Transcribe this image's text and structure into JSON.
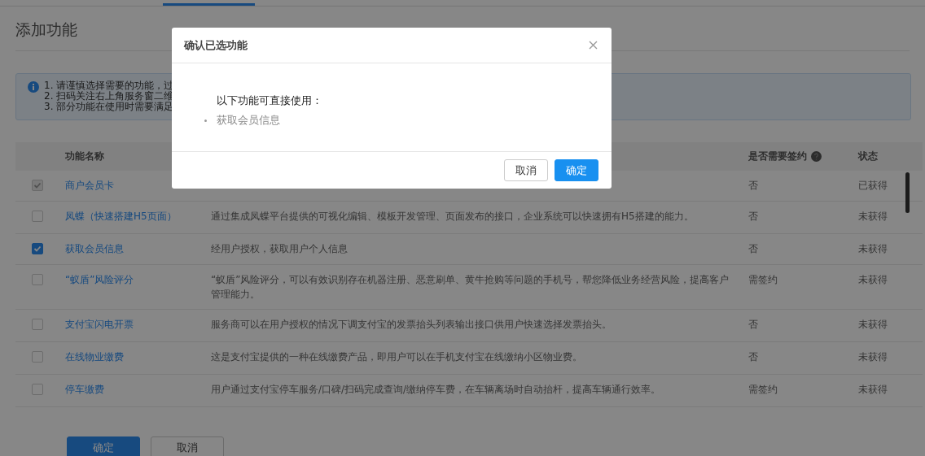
{
  "page": {
    "title": "添加功能"
  },
  "notice": [
    "1. 请谨慎选择需要的功能，过",
    "2. 扫码关注右上角服务窗二维",
    "3. 部分功能在使用时需要满足"
  ],
  "table": {
    "columns": [
      "功能名称",
      "是否需要签约",
      "状态"
    ],
    "rows": [
      {
        "name": "商户会员卡",
        "checked": true,
        "disabled": true,
        "sign": "否",
        "status": "已获得"
      },
      {
        "name": "凤蝶（快速搭建H5页面）",
        "checked": false,
        "disabled": false,
        "description": "通过集成凤蝶平台提供的可视化编辑、模板开发管理、页面发布的接口，企业系统可以快速拥有H5搭建的能力。",
        "sign": "否",
        "status": "未获得"
      },
      {
        "name": "获取会员信息",
        "checked": true,
        "disabled": false,
        "description": "经用户授权，获取用户个人信息",
        "sign": "否",
        "status": "未获得"
      },
      {
        "name": "“蚁盾”风险评分",
        "checked": false,
        "disabled": false,
        "description": "“蚁盾”风险评分，可以有效识别存在机器注册、恶意刷单、黄牛抢购等问题的手机号，帮您降低业务经营风险，提高客户管理能力。",
        "sign": "需签约",
        "status": "未获得"
      },
      {
        "name": "支付宝闪电开票",
        "checked": false,
        "disabled": false,
        "description": "服务商可以在用户授权的情况下调支付宝的发票抬头列表输出接口供用户快速选择发票抬头。",
        "sign": "否",
        "status": "未获得"
      },
      {
        "name": "在线物业缴费",
        "checked": false,
        "disabled": false,
        "description": "这是支付宝提供的一种在线缴费产品，即用户可以在手机支付宝在线缴纳小区物业费。",
        "sign": "否",
        "status": "未获得"
      },
      {
        "name": "停车缴费",
        "checked": false,
        "disabled": false,
        "description": "用户通过支付宝停车服务/口碑/扫码完成查询/缴纳停车费，在车辆离场时自动抬杆，提高车辆通行效率。",
        "sign": "需签约",
        "status": "未获得"
      }
    ]
  },
  "buttons": [
    "确定",
    "取消"
  ],
  "modal": {
    "title": "确认已选功能",
    "message": "以下功能可直接使用：",
    "items": [
      "获取会员信息"
    ],
    "buttons": [
      "取消",
      "确定"
    ]
  }
}
